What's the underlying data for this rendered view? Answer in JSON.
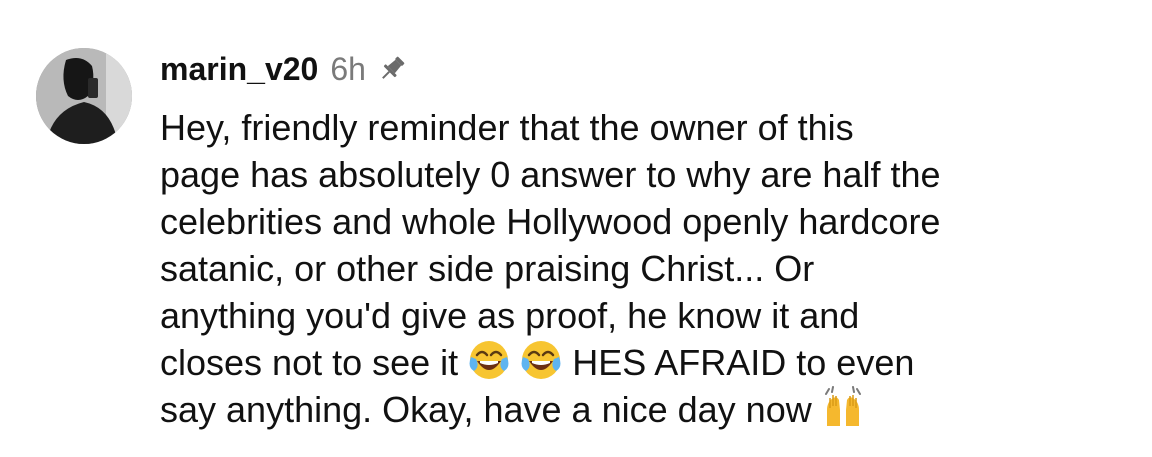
{
  "comment": {
    "username": "marin_v20",
    "time": "6h",
    "pinned": true,
    "lines": [
      "Hey, friendly reminder that the owner of this",
      "page has absolutely 0 answer to why are half the",
      "celebrities and whole Hollywood openly hardcore",
      "satanic, or other side praising Christ... Or",
      "anything you'd give as proof, he know it and"
    ],
    "line6_before": "closes not to see it",
    "line6_after": "HES AFRAID to even",
    "line7_text": "say anything. Okay, have a nice day now",
    "emojis": {
      "laugh": "face-with-tears-of-joy",
      "raise": "raising-hands"
    }
  }
}
